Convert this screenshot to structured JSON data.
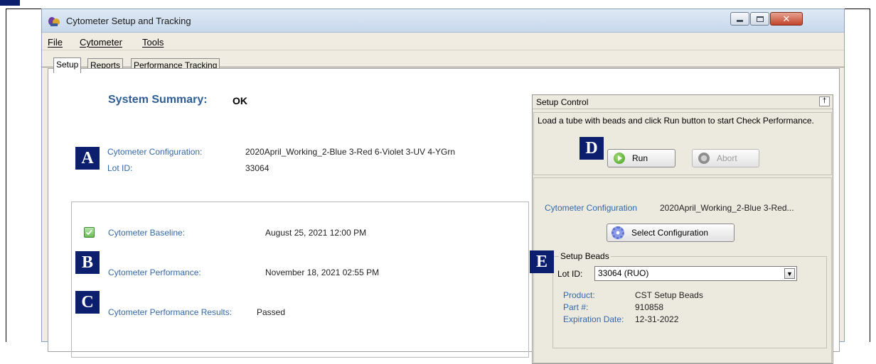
{
  "window": {
    "title": "Cytometer Setup and Tracking"
  },
  "menu": [
    "File",
    "Cytometer",
    "Tools"
  ],
  "tabs": [
    "Setup",
    "Reports",
    "Performance Tracking"
  ],
  "summary": {
    "title": "System Summary:",
    "status": "OK",
    "config_label": "Cytometer Configuration:",
    "config_value": "2020April_Working_2-Blue 3-Red 6-Violet 3-UV 4-YGrn",
    "lot_label": "Lot ID:",
    "lot_value": "33064"
  },
  "details": {
    "baseline_label": "Cytometer Baseline:",
    "baseline_value": "August 25, 2021 12:00 PM",
    "performance_label": "Cytometer Performance:",
    "performance_value": "November 18, 2021 02:55 PM",
    "results_label": "Cytometer Performance Results:",
    "results_value": "Passed"
  },
  "setup_control": {
    "title": "Setup Control",
    "pin": "†",
    "message": "Load a tube with beads and click Run button to start Check Performance.",
    "run_label": "Run",
    "abort_label": "Abort",
    "config_label": "Cytometer Configuration",
    "config_value": "2020April_Working_2-Blue 3-Red...",
    "select_config_label": "Select Configuration",
    "beads_legend": "Setup Beads",
    "lot_label": "Lot ID:",
    "lot_value": "33064 (RUO)",
    "product_label": "Product:",
    "product_value": "CST Setup Beads",
    "part_label": "Part #:",
    "part_value": "910858",
    "expiration_label": "Expiration Date:",
    "expiration_value": "12-31-2022"
  },
  "markers": [
    "A",
    "B",
    "C",
    "D",
    "E"
  ],
  "colors": {
    "marker_bg": "#0b1f6e",
    "link_blue": "#3468a8",
    "title_blue": "#2f5d95"
  },
  "icons": {
    "app": "cytometer-app-icon",
    "check": "check-icon",
    "run": "play-icon",
    "abort": "stop-icon",
    "select": "gear-icon",
    "dropdown": "chevron-down-icon"
  }
}
